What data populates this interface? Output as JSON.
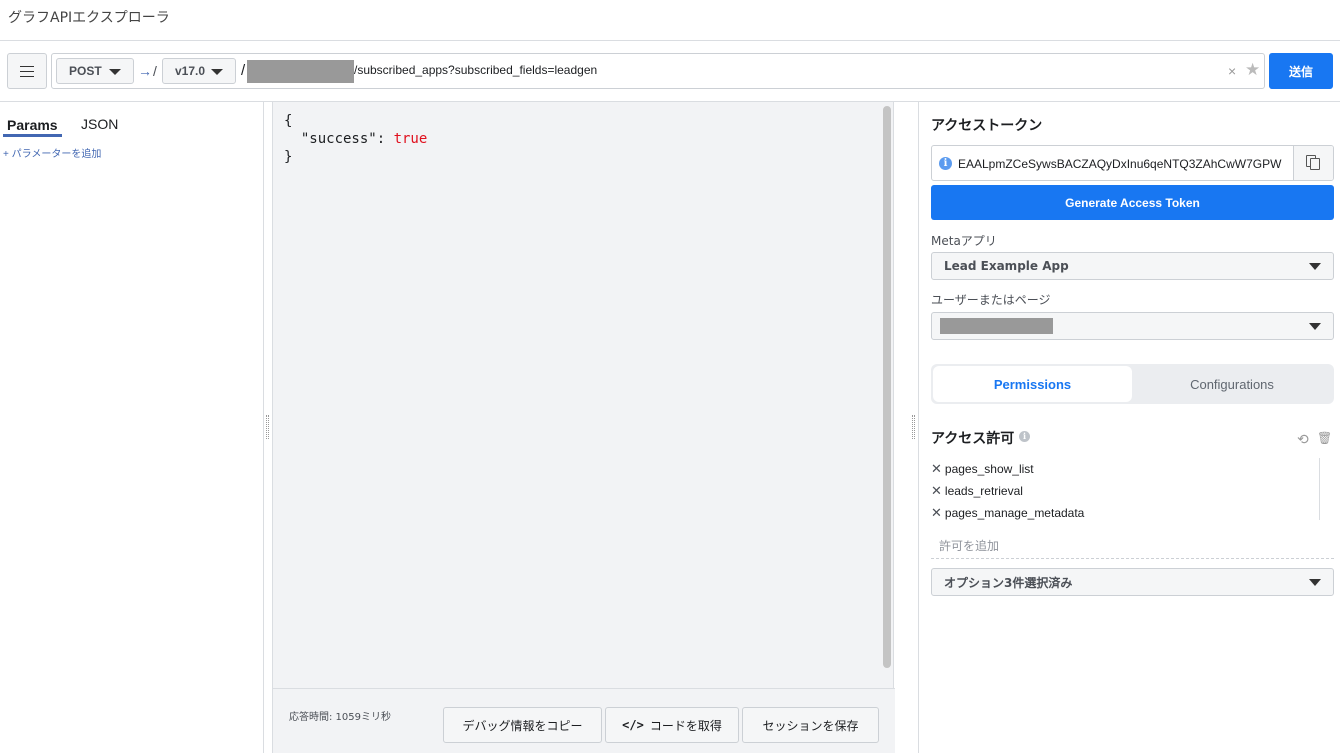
{
  "app_title": "グラフAPIエクスプローラ",
  "query": {
    "method": "POST",
    "version": "v17.0",
    "path_suffix": "/subscribed_apps?subscribed_fields=leadgen",
    "send_label": "送信"
  },
  "params": {
    "tab_params": "Params",
    "tab_json": "JSON",
    "add_param": "+ パラメーターを追加"
  },
  "response": {
    "open_brace": "{",
    "key": "\"success\"",
    "colon": ": ",
    "value": "true",
    "close_brace": "}",
    "time_label": "応答時間: 1059ミリ秒",
    "copy_debug_label": "デバッグ情報をコピー",
    "get_code_label": "コードを取得",
    "save_session_label": "セッションを保存"
  },
  "token": {
    "heading": "アクセストークン",
    "value": "EAALpmZCeSywsBACZAQyDxInu6qeNTQ3ZAhCwW7GPW",
    "generate_label": "Generate Access Token"
  },
  "meta_app": {
    "label": "Metaアプリ",
    "selected": "Lead Example App"
  },
  "user_or_page": {
    "label": "ユーザーまたはページ"
  },
  "tabs": {
    "permissions": "Permissions",
    "configurations": "Configurations"
  },
  "permissions": {
    "heading": "アクセス許可",
    "items": [
      "pages_show_list",
      "leads_retrieval",
      "pages_manage_metadata"
    ],
    "add_placeholder": "許可を追加",
    "options_summary": "オプション3件選択済み"
  },
  "colors": {
    "accent": "#1877f2",
    "link": "#4267b2",
    "bool": "#e0101e"
  }
}
